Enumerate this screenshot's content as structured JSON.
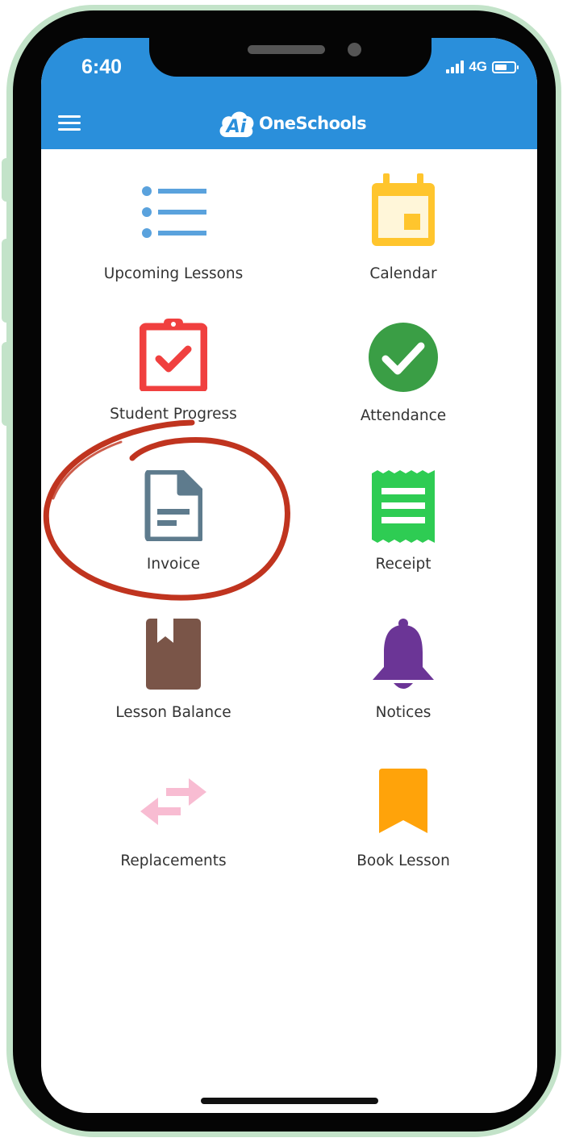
{
  "status_bar": {
    "time": "6:40",
    "network": "4G"
  },
  "header": {
    "brand_mark": "Ai",
    "brand_name": "OneSchools",
    "menu_icon": "hamburger-menu-icon",
    "background_color": "#2a8fdb"
  },
  "menu": {
    "items": [
      {
        "label": "Upcoming Lessons",
        "icon": "list-icon",
        "color": "#5aa2dd"
      },
      {
        "label": "Calendar",
        "icon": "calendar-icon",
        "color": "#ffc52d"
      },
      {
        "label": "Student Progress",
        "icon": "clipboard-check-icon",
        "color": "#f0403f"
      },
      {
        "label": "Attendance",
        "icon": "checkmark-circle-icon",
        "color": "#3a9e45"
      },
      {
        "label": "Invoice",
        "icon": "document-icon",
        "color": "#5e7b8d"
      },
      {
        "label": "Receipt",
        "icon": "receipt-icon",
        "color": "#2ecc53"
      },
      {
        "label": "Lesson Balance",
        "icon": "book-bookmark-icon",
        "color": "#7a5548"
      },
      {
        "label": "Notices",
        "icon": "bell-icon",
        "color": "#6b3596"
      },
      {
        "label": "Replacements",
        "icon": "swap-arrows-icon",
        "color": "#f8bcd2"
      },
      {
        "label": "Book Lesson",
        "icon": "bookmark-icon",
        "color": "#ffa30a"
      }
    ]
  },
  "annotation": {
    "highlighted_item": "Invoice",
    "color": "#c0341f"
  }
}
